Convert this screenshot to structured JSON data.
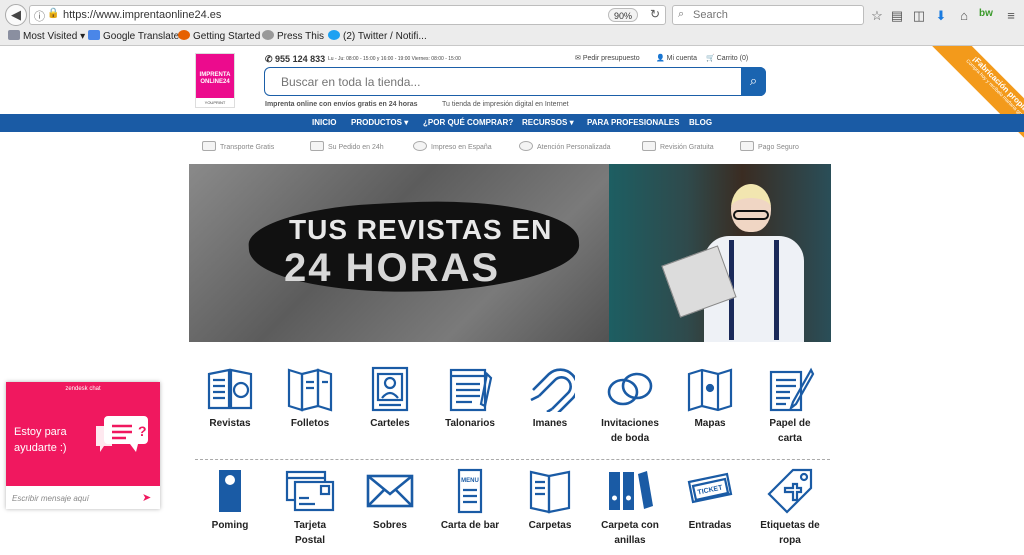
{
  "browser": {
    "url": "https://www.imprentaonline24.es",
    "zoom": "90%",
    "search_placeholder": "Search",
    "bookmarks": [
      "Most Visited",
      "Google Translate",
      "Getting Started",
      "Press This",
      "(2) Twitter / Notifi..."
    ]
  },
  "site": {
    "logo_line1": "IMPRENTA",
    "logo_line2": "ONLINE24",
    "logo_sub": "YOUPRINT",
    "phone": "955 124 833",
    "hours": "Lu - Ju: 08:00 - 15:00 y 16:00 - 19:00 Viernes: 08:00 - 15:00",
    "top_links": {
      "quote": "Pedir presupuesto",
      "account": "Mi cuenta",
      "cart": "Carrito (0)"
    },
    "search_placeholder": "Buscar en toda la tienda...",
    "tagline_bold": "Imprenta online con envíos gratis en 24 horas",
    "tagline": "Tu tienda de impresión digital en Internet",
    "ribbon_title": "¡Fabricación propia!",
    "ribbon_sub": "Compra hoy y recíbelo mañana gratis",
    "nav": [
      "INICIO",
      "PRODUCTOS",
      "¿POR QUÉ COMPRAR?",
      "RECURSOS",
      "PARA PROFESIONALES",
      "BLOG"
    ],
    "features": [
      "Transporte Gratis",
      "Su Pedido en 24h",
      "Impreso en España",
      "Atención Personalizada",
      "Revisión Gratuita",
      "Pago Seguro"
    ],
    "banner_line1": "TUS REVISTAS EN",
    "banner_line2": "24 HORAS",
    "products_row1": [
      {
        "l1": "Revistas",
        "l2": ""
      },
      {
        "l1": "Folletos",
        "l2": ""
      },
      {
        "l1": "Carteles",
        "l2": ""
      },
      {
        "l1": "Talonarios",
        "l2": ""
      },
      {
        "l1": "Imanes",
        "l2": ""
      },
      {
        "l1": "Invitaciones",
        "l2": "de boda"
      },
      {
        "l1": "Mapas",
        "l2": ""
      },
      {
        "l1": "Papel de",
        "l2": "carta"
      }
    ],
    "products_row2": [
      {
        "l1": "Poming",
        "l2": ""
      },
      {
        "l1": "Tarjeta",
        "l2": "Postal"
      },
      {
        "l1": "Sobres",
        "l2": ""
      },
      {
        "l1": "Carta de bar",
        "l2": ""
      },
      {
        "l1": "Carpetas",
        "l2": ""
      },
      {
        "l1": "Carpeta con",
        "l2": "anillas"
      },
      {
        "l1": "Entradas",
        "l2": ""
      },
      {
        "l1": "Etiquetas de",
        "l2": "ropa"
      }
    ],
    "menu_icon_text": "MENU",
    "ticket_icon_text": "TICKET"
  },
  "chat": {
    "brand": "zendesk chat",
    "message": "Estoy para ayudarte :)",
    "input_placeholder": "Escribir mensaje aquí"
  },
  "colors": {
    "brand_blue": "#1a5ba5",
    "brand_pink": "#ec0b8d",
    "ribbon_orange": "#f39a1b",
    "chat_pink": "#f0185f"
  }
}
